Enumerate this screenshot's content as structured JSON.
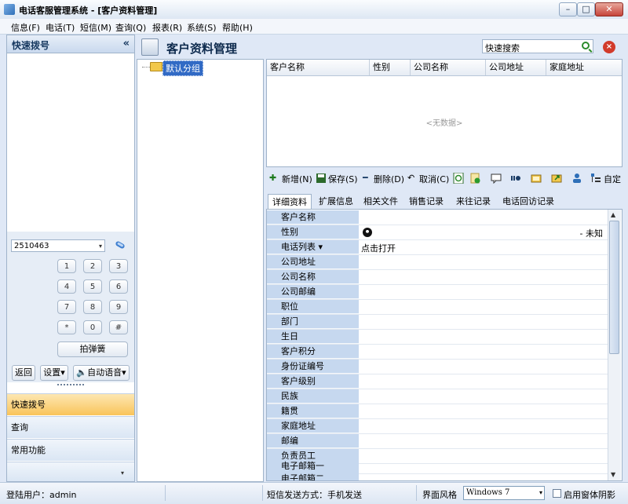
{
  "window": {
    "title": "电话客服管理系统 - [客户资料管理]",
    "minimize_glyph": "–",
    "maximize_glyph": "□",
    "close_glyph": "✕"
  },
  "menu": [
    {
      "label": "信息(F)"
    },
    {
      "label": "电话(T)"
    },
    {
      "label": "短信(M)"
    },
    {
      "label": "查询(Q)"
    },
    {
      "label": "报表(R)"
    },
    {
      "label": "系统(S)"
    },
    {
      "label": "帮助(H)"
    }
  ],
  "left_panel": {
    "title": "快速拨号",
    "collapse_glyph": "«",
    "dial_number": "2510463",
    "dropdown_glyph": "▾",
    "keypad": [
      "1",
      "2",
      "3",
      "4",
      "5",
      "6",
      "7",
      "8",
      "9",
      "*",
      "0",
      "#"
    ],
    "redial_label": "拍弹簧",
    "back_label": "返回",
    "settings_label": "设置",
    "auto_voice_label": "自动语音",
    "menu_glyph": "▾",
    "nav": [
      {
        "label": "快速拨号"
      },
      {
        "label": "查询"
      },
      {
        "label": "常用功能"
      }
    ],
    "nav_more_glyph": "▾"
  },
  "main": {
    "title": "客户资料管理",
    "search_text": "快速搜索",
    "close_glyph": "×"
  },
  "tree": {
    "root_label": "默认分组"
  },
  "grid": {
    "columns": [
      "客户名称",
      "性别",
      "公司名称",
      "公司地址",
      "家庭地址"
    ],
    "empty_text": "<无数据>"
  },
  "actions": {
    "add": "新增(N)",
    "save": "保存(S)",
    "delete": "删除(D)",
    "cancel": "取消(C)",
    "custom": "自定",
    "add_glyph": "✚",
    "delete_glyph": "━",
    "cancel_glyph": "↶"
  },
  "tabs": [
    "详细资料",
    "扩展信息",
    "相关文件",
    "销售记录",
    "来往记录",
    "电话回访记录"
  ],
  "form": {
    "fields": [
      "客户名称",
      "性别",
      "电话列表",
      "公司地址",
      "公司名称",
      "公司邮编",
      "职位",
      "部门",
      "生日",
      "客户积分",
      "身份证编号",
      "客户级别",
      "民族",
      "籍贯",
      "家庭地址",
      "邮编",
      "负责员工",
      "电子邮箱一",
      "电子邮箱二"
    ],
    "phone_list_glyph": "▾",
    "gender_value": "- 未知",
    "phone_open_text": "点击打开",
    "scroll_up_glyph": "▲",
    "scroll_down_glyph": "▼"
  },
  "status": {
    "user": "登陆用户：admin",
    "sms_mode": "短信发送方式：手机发送",
    "style_label": "界面风格",
    "style_value": "Windows 7",
    "style_dropdown_glyph": "▾",
    "shadow_label": "启用窗体阴影"
  },
  "colors": {
    "accent": "#316ac5",
    "nav_active": "#f9c45a",
    "label_bg": "#c6d8ef"
  }
}
